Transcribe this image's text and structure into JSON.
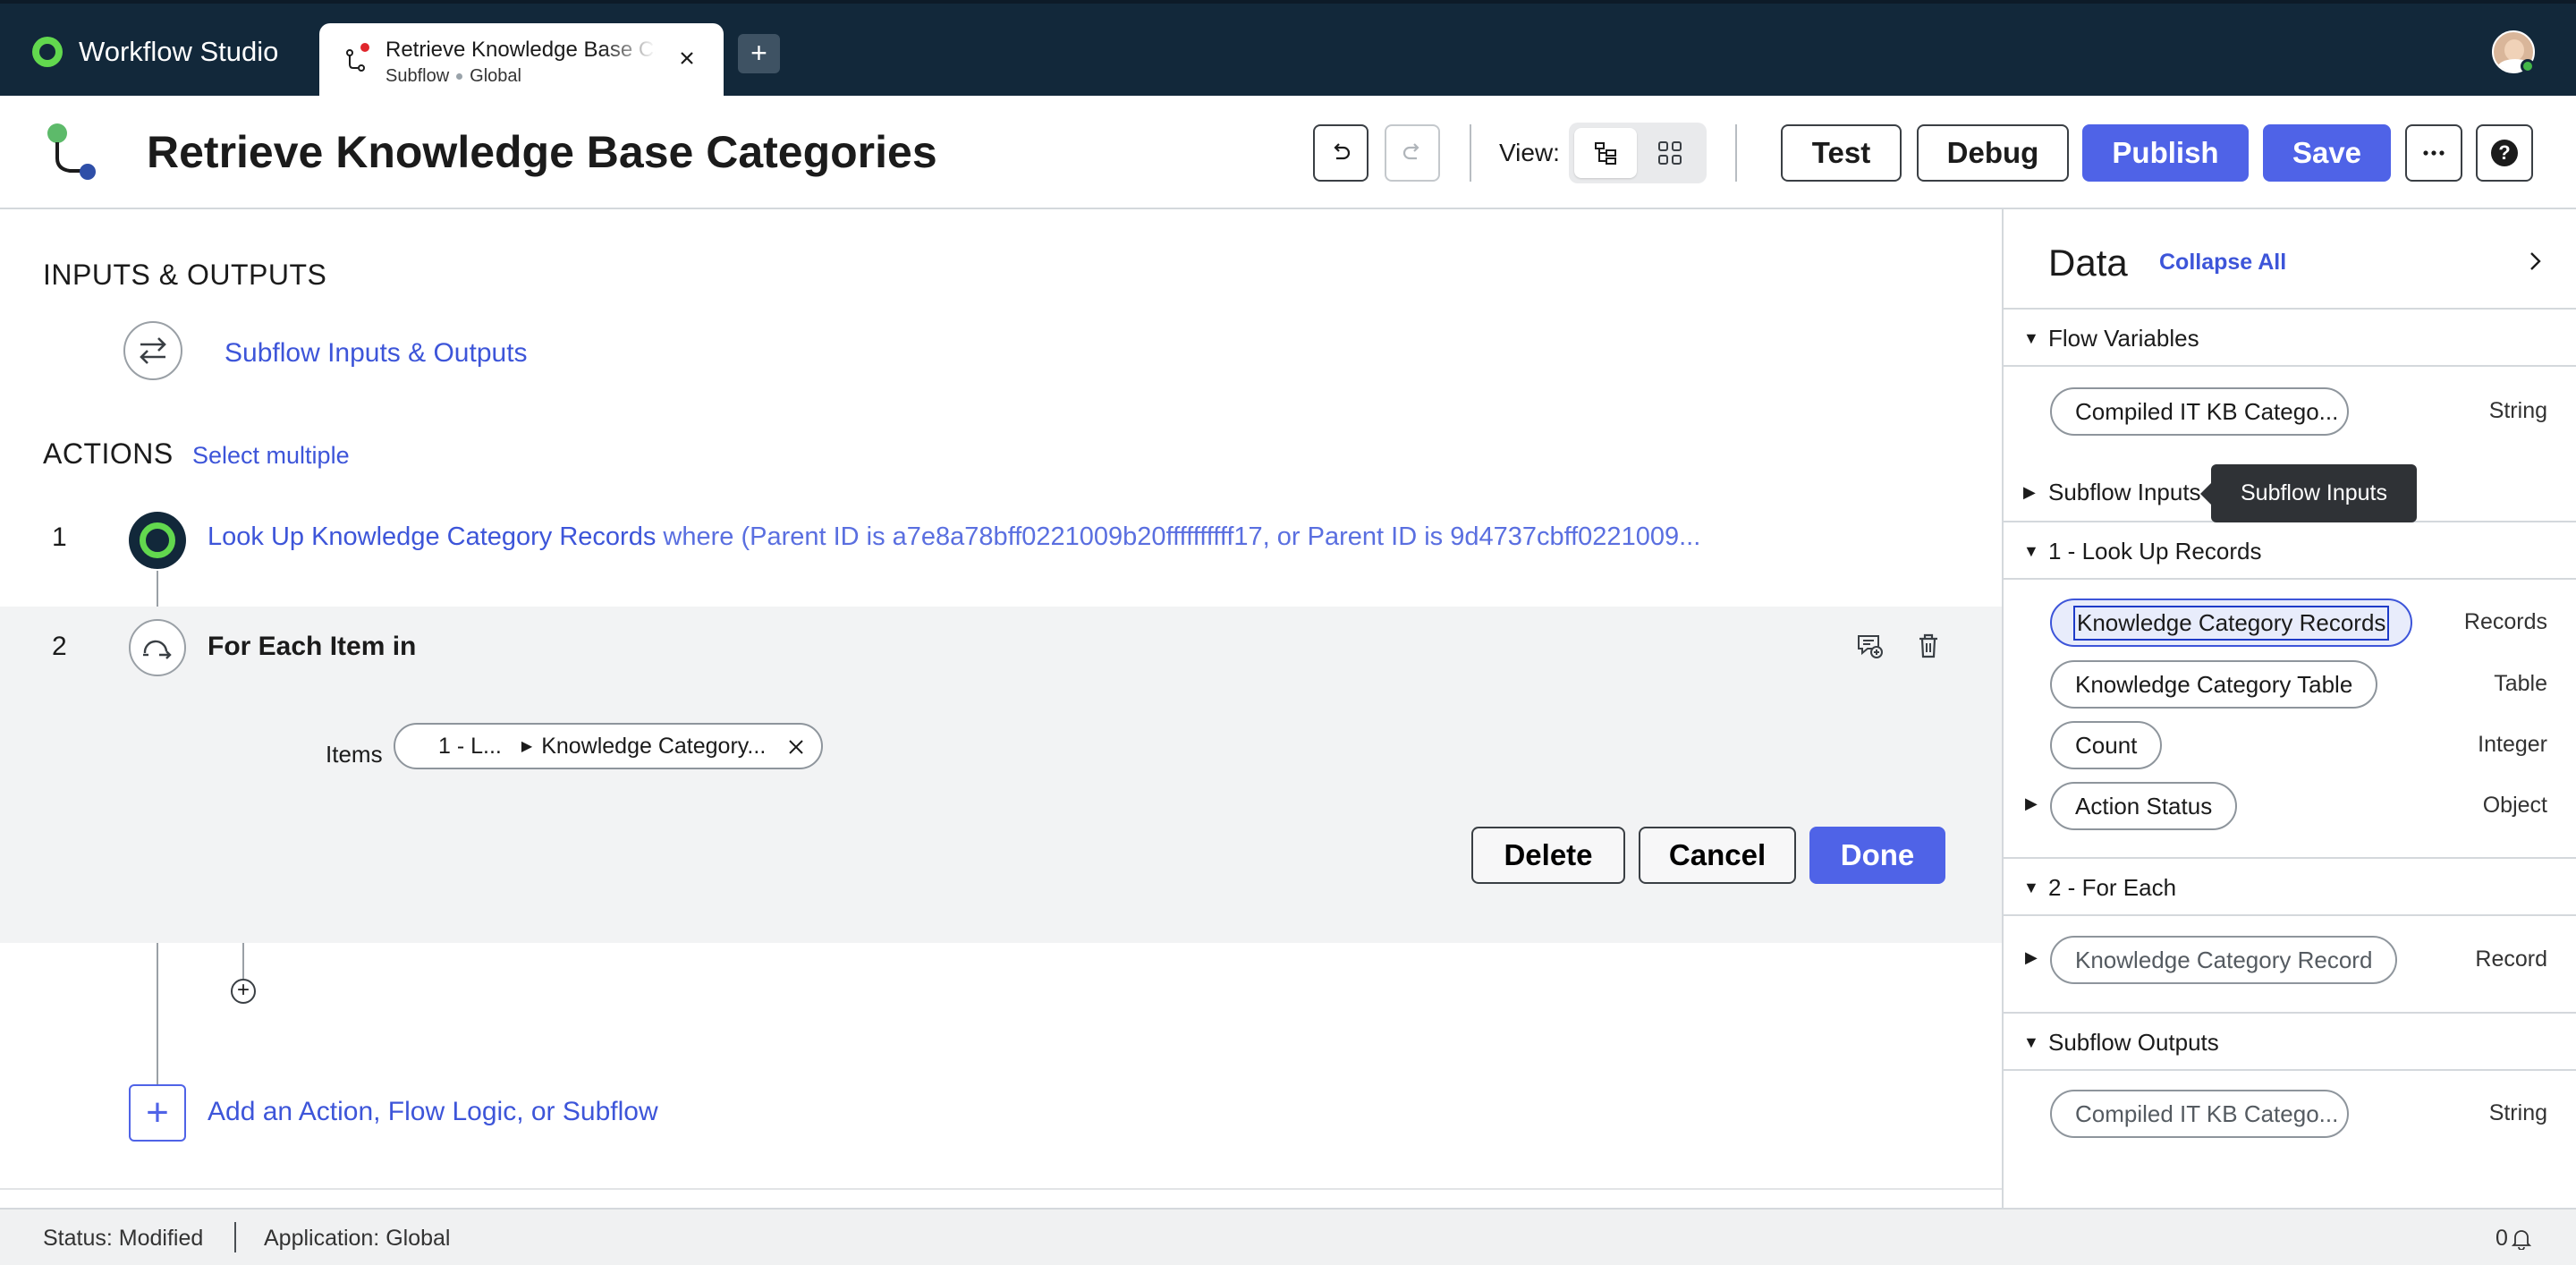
{
  "app": {
    "name": "Workflow Studio"
  },
  "tab": {
    "title": "Retrieve Knowledge Base Categories",
    "type": "Subflow",
    "scope": "Global"
  },
  "header": {
    "title": "Retrieve Knowledge Base Categories",
    "view_label": "View:",
    "buttons": {
      "test": "Test",
      "debug": "Debug",
      "publish": "Publish",
      "save": "Save",
      "more": "...",
      "help": "?"
    }
  },
  "main": {
    "io_section_title": "INPUTS & OUTPUTS",
    "io_link": "Subflow Inputs & Outputs",
    "actions_title": "ACTIONS",
    "select_multiple": "Select multiple",
    "step1": {
      "number": "1",
      "text": "Look Up Knowledge Category Records",
      "condition": "where (Parent ID is a7e8a78bff0221009b20ffffffffff17, or Parent ID is 9d4737cbff0221009..."
    },
    "step2": {
      "number": "2",
      "title": "For Each Item in",
      "items_label": "Items",
      "items_pill_first": "1 - L...",
      "items_pill_second": "Knowledge Category...",
      "buttons": {
        "delete": "Delete",
        "cancel": "Cancel",
        "done": "Done"
      }
    },
    "add_link": "Add an Action, Flow Logic, or Subflow"
  },
  "panel": {
    "title": "Data",
    "collapse_all": "Collapse All",
    "groups": {
      "flow_variables": "Flow Variables",
      "subflow_inputs": "Subflow Inputs",
      "lookup": "1 - Look Up Records",
      "foreach": "2 - For Each",
      "subflow_outputs": "Subflow Outputs"
    },
    "flow_var": {
      "name": "Compiled IT KB Catego...",
      "type": "String"
    },
    "lookup_items": [
      {
        "name": "Knowledge Category Records",
        "type": "Records"
      },
      {
        "name": "Knowledge Category Table",
        "type": "Table"
      },
      {
        "name": "Count",
        "type": "Integer"
      },
      {
        "name": "Action Status",
        "type": "Object"
      }
    ],
    "foreach_item": {
      "name": "Knowledge Category Record",
      "type": "Record"
    },
    "output_item": {
      "name": "Compiled IT KB Catego...",
      "type": "String"
    },
    "tooltip": "Subflow Inputs"
  },
  "status": {
    "status_text": "Status: Modified",
    "application_text": "Application: Global",
    "notifications": "0"
  },
  "colors": {
    "accent": "#4f63e7",
    "topbar": "#12283a",
    "brand_green": "#62d84e",
    "link": "#3d55d9"
  }
}
